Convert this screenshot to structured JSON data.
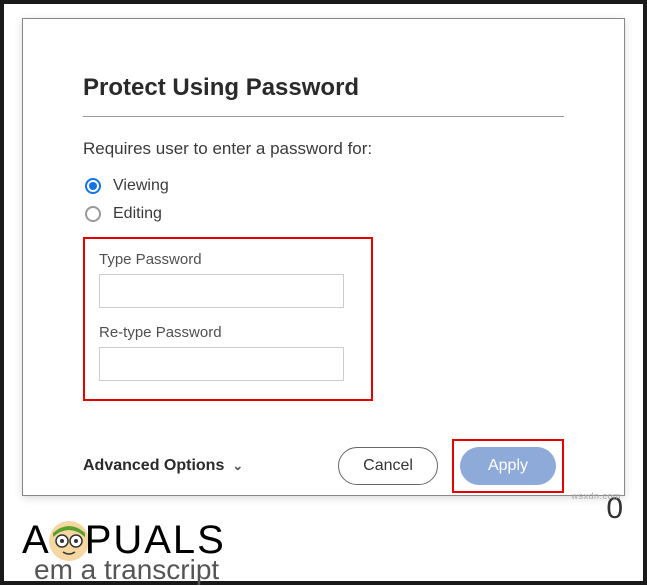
{
  "dialog": {
    "title": "Protect Using Password",
    "subtitle": "Requires user to enter a password for:",
    "radios": {
      "viewing": "Viewing",
      "editing": "Editing"
    },
    "password_section": {
      "type_label": "Type Password",
      "retype_label": "Re-type Password"
    },
    "advanced_label": "Advanced Options",
    "buttons": {
      "cancel": "Cancel",
      "apply": "Apply"
    }
  },
  "background": {
    "logo_text_before": "A",
    "logo_text_after": "PUALS",
    "partial_text": "em a transcript",
    "num": "0"
  },
  "watermark": "wsxdn.com"
}
